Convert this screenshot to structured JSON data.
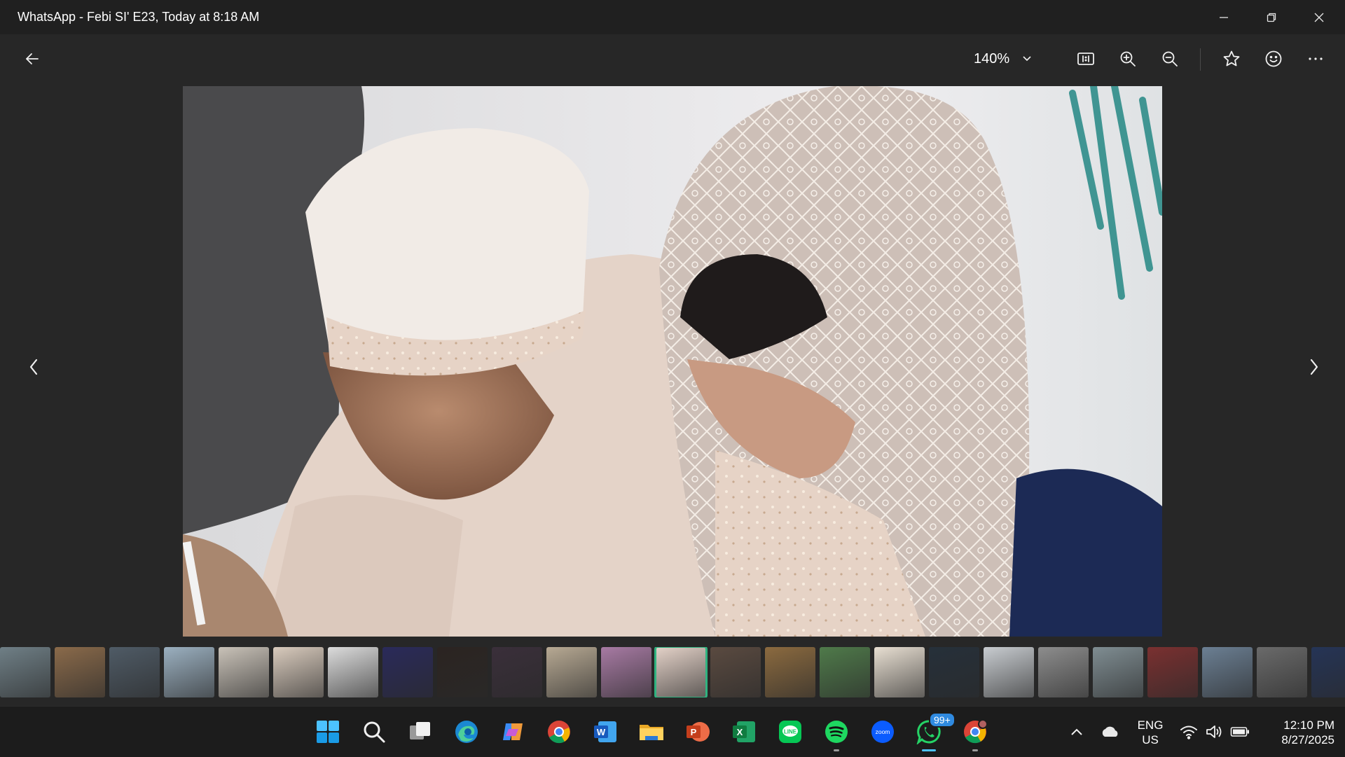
{
  "window": {
    "title": "WhatsApp - Febi SI' E23, Today at 8:18 AM",
    "controls": [
      "minimize",
      "restore",
      "close"
    ]
  },
  "toolbar": {
    "zoom_level": "140%",
    "actions": [
      "back-icon",
      "actual-size-icon",
      "zoom-in-icon",
      "zoom-out-icon",
      "favorite-icon",
      "emoji-icon",
      "more-icon"
    ]
  },
  "viewer": {
    "prev_icon": "chevron-left-icon",
    "next_icon": "chevron-right-icon"
  },
  "filmstrip": {
    "thumbnails": [
      {
        "color": "#6f7f86"
      },
      {
        "color": "#8a6a4a"
      },
      {
        "color": "#4f5b66"
      },
      {
        "color": "#9bb0c0"
      },
      {
        "color": "#c9c2b8"
      },
      {
        "color": "#d9cbbd"
      },
      {
        "color": "#dcdcdc"
      },
      {
        "color": "#2a2a5a"
      },
      {
        "color": "#2b2421"
      },
      {
        "color": "#3a2f3a"
      },
      {
        "color": "#b7a993"
      },
      {
        "color": "#a77aa3"
      },
      {
        "color": "#e4d2c8"
      },
      {
        "color": "#5a4a40"
      },
      {
        "color": "#8b6a3f"
      },
      {
        "color": "#4f7a4a"
      },
      {
        "color": "#e8dfd2"
      },
      {
        "color": "#26303a"
      },
      {
        "color": "#c8ccd0"
      },
      {
        "color": "#8d8d8d"
      },
      {
        "color": "#7f8d92"
      },
      {
        "color": "#7a3030"
      },
      {
        "color": "#6b7f93"
      },
      {
        "color": "#6a6a6a"
      },
      {
        "color": "#253456"
      }
    ],
    "selected_index": 12,
    "accent_color": "#2fb380"
  },
  "taskbar": {
    "apps": [
      "windows-start",
      "search",
      "task-view",
      "edge",
      "copilot",
      "chrome",
      "word",
      "file-explorer",
      "powerpoint",
      "excel",
      "line",
      "spotify",
      "zoom",
      "whatsapp",
      "chrome-profile"
    ],
    "zoom_label": "zoom",
    "whatsapp_badge": "99+",
    "language_line1": "ENG",
    "language_line2": "US",
    "time": "12:10 PM",
    "date": "8/27/2025"
  }
}
